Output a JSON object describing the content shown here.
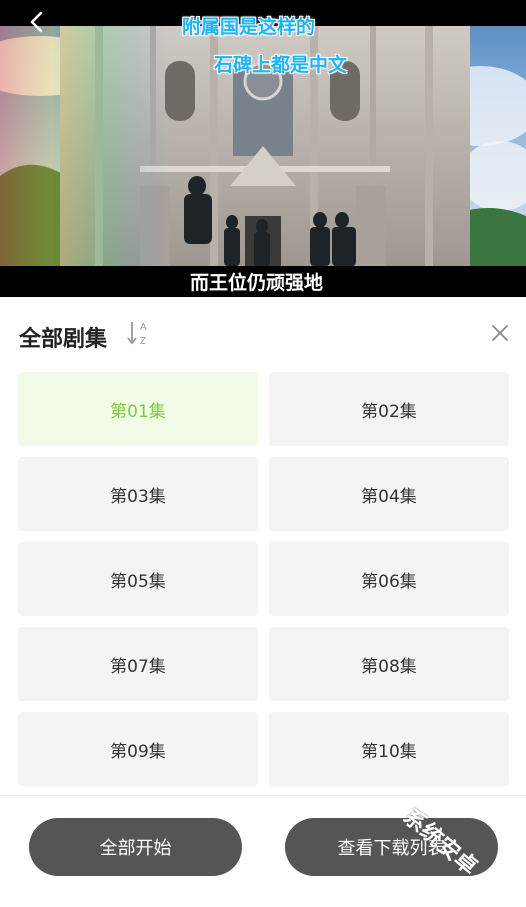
{
  "video": {
    "subtitle_line1": "附属国是这样的",
    "subtitle_line2": "石碑上都是中文",
    "subtitle_bottom": "而王位仍顽强地"
  },
  "panel": {
    "title": "全部剧集",
    "sort_icon": "sort-az-icon",
    "close_icon": "close-icon"
  },
  "episodes": [
    {
      "label": "第01集",
      "active": true
    },
    {
      "label": "第02集",
      "active": false
    },
    {
      "label": "第03集",
      "active": false
    },
    {
      "label": "第04集",
      "active": false
    },
    {
      "label": "第05集",
      "active": false
    },
    {
      "label": "第06集",
      "active": false
    },
    {
      "label": "第07集",
      "active": false
    },
    {
      "label": "第08集",
      "active": false
    },
    {
      "label": "第09集",
      "active": false
    },
    {
      "label": "第10集",
      "active": false
    }
  ],
  "actions": {
    "start_all": "全部开始",
    "view_downloads": "查看下载列表"
  },
  "watermark": "系统安卓",
  "colors": {
    "active_text": "#7ccc3e",
    "active_bg": "#f1fbe8",
    "pill_bg": "#555555",
    "subtitle_blue": "#1fb4f6"
  }
}
